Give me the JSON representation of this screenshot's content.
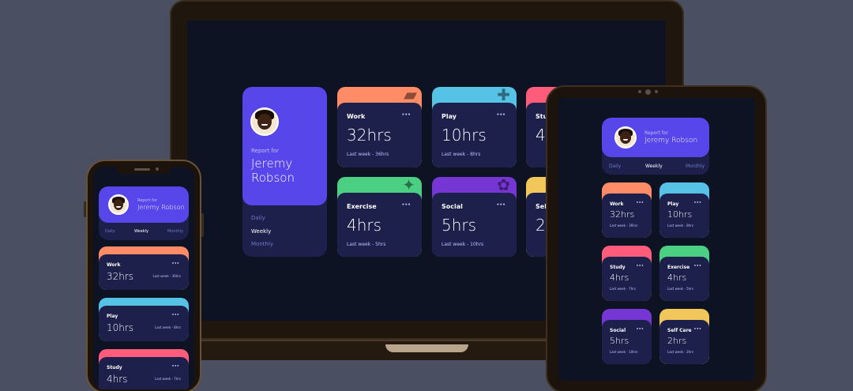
{
  "profile": {
    "report_for": "Report for",
    "name_line1": "Jeremy",
    "name_line2": "Robson",
    "name_full": "Jeremy Robson"
  },
  "periods": [
    "Daily",
    "Weekly",
    "Monthly"
  ],
  "active_period": "Weekly",
  "dots": "•••",
  "cards": [
    {
      "title": "Work",
      "hours": "32hrs",
      "prev": "Last week - 36hrs",
      "color": "#ff8c66",
      "icon": "briefcase-icon"
    },
    {
      "title": "Play",
      "hours": "10hrs",
      "prev": "Last week - 8hrs",
      "color": "#56c2e6",
      "icon": "gamepad-icon"
    },
    {
      "title": "Study",
      "hours": "4hrs",
      "prev": "Last week - 7hrs",
      "color": "#ff5c7c",
      "icon": "book-icon"
    },
    {
      "title": "Exercise",
      "hours": "4hrs",
      "prev": "Last week - 5hrs",
      "color": "#4bcf83",
      "icon": "runner-icon"
    },
    {
      "title": "Social",
      "hours": "5hrs",
      "prev": "Last week - 10hrs",
      "color": "#7536d3",
      "icon": "social-icon"
    },
    {
      "title": "Self Care",
      "hours": "2hrs",
      "prev": "Last week - 2hrs",
      "color": "#f1c75b",
      "icon": "selfcare-icon"
    }
  ],
  "laptop_cut": {
    "study_title": "Stu",
    "study_hours": "4",
    "selfcare_title": "Self",
    "selfcare_hours": "2"
  },
  "phone_cut": {
    "study_hours": "4hrs"
  }
}
